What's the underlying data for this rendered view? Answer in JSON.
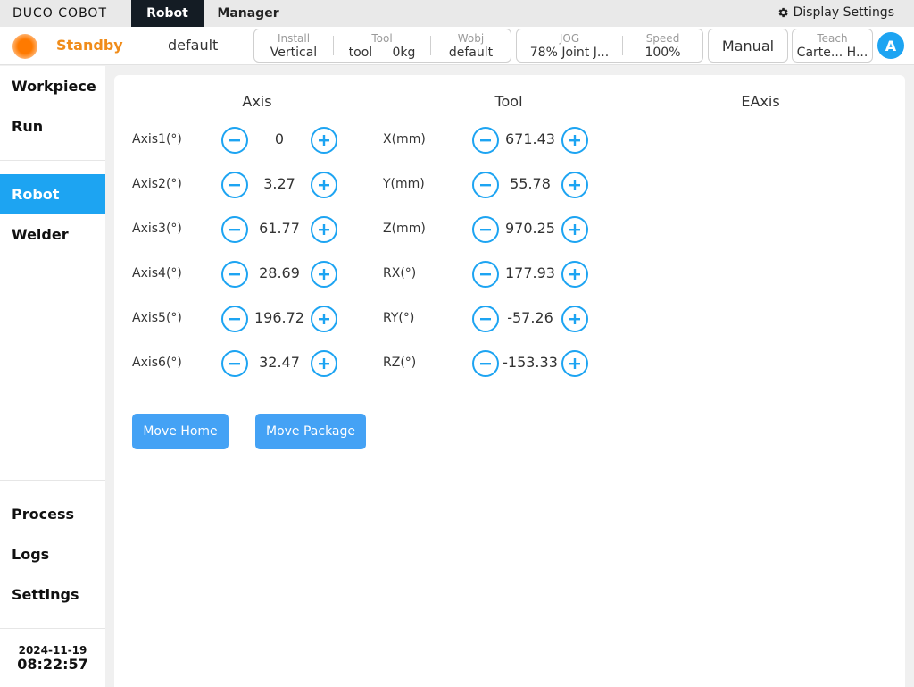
{
  "header": {
    "logo_text": "DUCO COBOT",
    "tabs": [
      {
        "label": "Robot"
      },
      {
        "label": "Manager"
      }
    ],
    "display_settings_label": "Display Settings"
  },
  "status": {
    "state": "Standby",
    "profile": "default",
    "install": {
      "label": "Install",
      "value": "Vertical"
    },
    "tool": {
      "label": "Tool",
      "name": "tool",
      "payload": "0kg"
    },
    "wobj": {
      "label": "Wobj",
      "value": "default"
    },
    "jog": {
      "label": "JOG",
      "value": "78%  Joint J..."
    },
    "speed": {
      "label": "Speed",
      "value": "100%"
    },
    "mode_button": "Manual",
    "teach": {
      "label": "Teach",
      "value": "Carte... H..."
    },
    "avatar_letter": "A"
  },
  "sidebar": {
    "top_items": [
      {
        "label": "Workpiece"
      },
      {
        "label": "Run"
      }
    ],
    "mid_items": [
      {
        "label": "Robot"
      },
      {
        "label": "Welder"
      }
    ],
    "bottom_items": [
      {
        "label": "Process"
      },
      {
        "label": "Logs"
      },
      {
        "label": "Settings"
      }
    ],
    "date": "2024-11-19",
    "time": "08:22:57"
  },
  "main": {
    "columns": {
      "axis": "Axis",
      "tool": "Tool",
      "eaxis": "EAxis"
    },
    "axis_rows": [
      {
        "label": "Axis1(°)",
        "value": "0"
      },
      {
        "label": "Axis2(°)",
        "value": "3.27"
      },
      {
        "label": "Axis3(°)",
        "value": "61.77"
      },
      {
        "label": "Axis4(°)",
        "value": "28.69"
      },
      {
        "label": "Axis5(°)",
        "value": "196.72"
      },
      {
        "label": "Axis6(°)",
        "value": "32.47"
      }
    ],
    "tool_rows": [
      {
        "label": "X(mm)",
        "value": "671.43"
      },
      {
        "label": "Y(mm)",
        "value": "55.78"
      },
      {
        "label": "Z(mm)",
        "value": "970.25"
      },
      {
        "label": "RX(°)",
        "value": "177.93"
      },
      {
        "label": "RY(°)",
        "value": "-57.26"
      },
      {
        "label": "RZ(°)",
        "value": "-153.33"
      }
    ],
    "move_home_label": "Move Home",
    "move_package_label": "Move Package"
  },
  "colors": {
    "accent": "#1da4f2",
    "standby": "#f08c1a",
    "dark_tab": "#141c24",
    "action_button": "#44a2f5"
  }
}
